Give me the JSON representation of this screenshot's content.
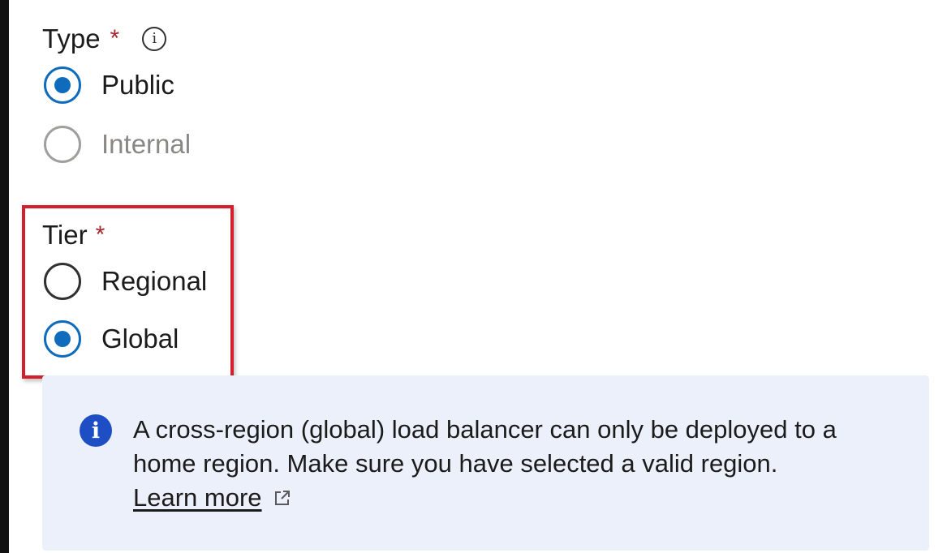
{
  "type_field": {
    "label": "Type",
    "required_marker": "*",
    "info_icon": "info-outline-icon",
    "options": [
      {
        "label": "Public",
        "selected": true,
        "disabled": false
      },
      {
        "label": "Internal",
        "selected": false,
        "disabled": true
      }
    ]
  },
  "tier_field": {
    "label": "Tier",
    "required_marker": "*",
    "options": [
      {
        "label": "Regional",
        "selected": false,
        "disabled": false
      },
      {
        "label": "Global",
        "selected": true,
        "disabled": false
      }
    ]
  },
  "info_message": {
    "icon": "info-filled-icon",
    "line1": "A cross-region (global) load balancer can only be deployed to a",
    "line2": "home region. Make sure you have selected a valid region.",
    "link_label": "Learn more",
    "link_icon": "external-link-icon"
  },
  "colors": {
    "accent": "#0f6cbd",
    "required": "#a4262c",
    "highlight": "#d21f2b",
    "message_background": "#ebf0fb",
    "info_icon": "#1d4ec4"
  }
}
